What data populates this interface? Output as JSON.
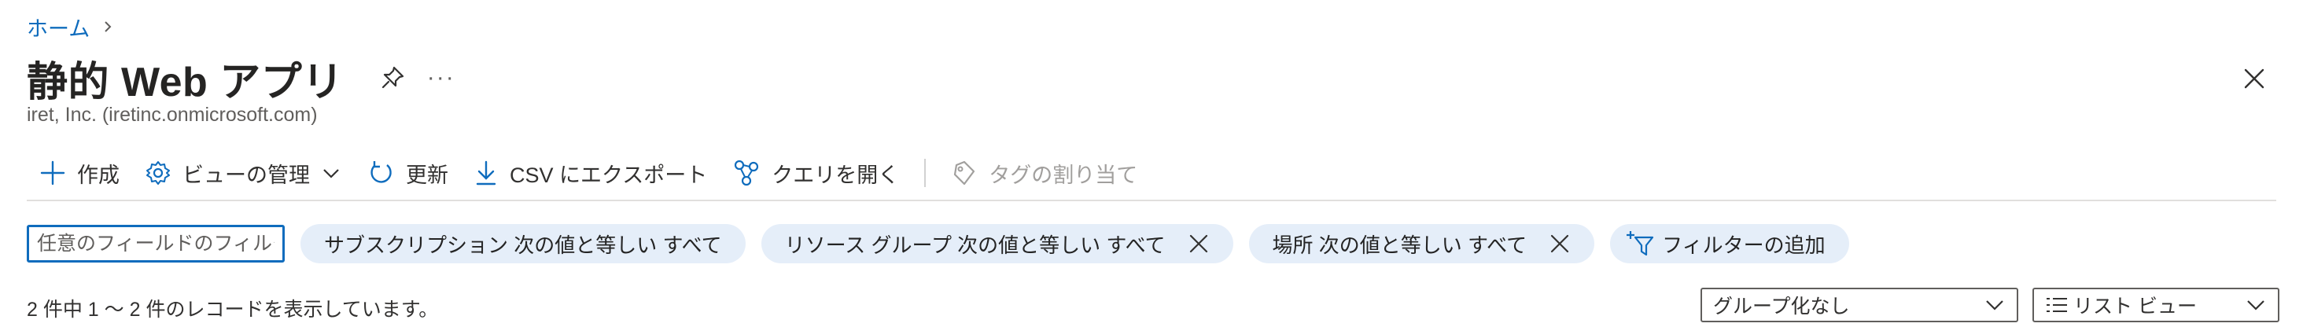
{
  "breadcrumb": {
    "home": "ホーム"
  },
  "header": {
    "title": "静的 Web アプリ",
    "subtitle": "iret, Inc. (iretinc.onmicrosoft.com)",
    "more": "···"
  },
  "toolbar": {
    "create": "作成",
    "manage_view": "ビューの管理",
    "refresh": "更新",
    "export_csv": "CSV にエクスポート",
    "open_query": "クエリを開く",
    "assign_tags": "タグの割り当て"
  },
  "filters": {
    "search_placeholder": "任意のフィールドのフィルター...",
    "subscription": "サブスクリプション 次の値と等しい すべて",
    "resource_group": "リソース グループ 次の値と等しい すべて",
    "location": "場所 次の値と等しい すべて",
    "add_filter": "フィルターの追加"
  },
  "status": {
    "record_count": "2 件中 1 ～ 2 件のレコードを表示しています。"
  },
  "grouping": {
    "selected": "グループ化なし"
  },
  "view_mode": {
    "selected": "リスト ビュー"
  },
  "colors": {
    "accent": "#0f6cbd",
    "pill_bg": "#e5eef9",
    "disabled": "#a19f9d"
  }
}
